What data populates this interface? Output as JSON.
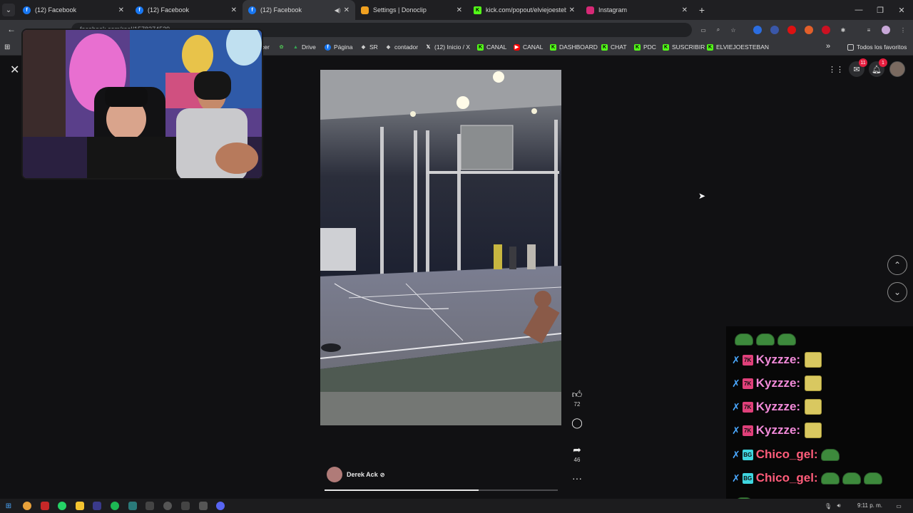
{
  "tabs": [
    {
      "title": "(12) Facebook",
      "favicon": "facebook-icon",
      "active": false
    },
    {
      "title": "(12) Facebook",
      "favicon": "facebook-icon",
      "active": false
    },
    {
      "title": "(12) Facebook",
      "favicon": "facebook-icon",
      "active": true,
      "audio": true
    },
    {
      "title": "Settings | Donoclip",
      "favicon": "donoclip-icon",
      "active": false
    },
    {
      "title": "kick.com/popout/elviejoesteban",
      "favicon": "kick-icon",
      "active": false
    },
    {
      "title": "Instagram",
      "favicon": "instagram-icon",
      "active": false
    }
  ],
  "address_bar": {
    "url": "facebook.com/reel/1578274529"
  },
  "bookmarks": {
    "items": [
      {
        "label": "cer",
        "icon": "bookmark-icon",
        "color": "#9aa0a6"
      },
      {
        "label": "",
        "icon": "leaf-icon",
        "color": "#4caf50"
      },
      {
        "label": "Drive",
        "icon": "drive-icon",
        "color": "#34a853"
      },
      {
        "label": "Página",
        "icon": "facebook-icon",
        "color": "#1877f2"
      },
      {
        "label": "SR",
        "icon": "diamond-icon",
        "color": "#cccccc"
      },
      {
        "label": "contador",
        "icon": "diamond-icon",
        "color": "#cccccc"
      },
      {
        "label": "(12) Inicio / X",
        "icon": "x-icon",
        "color": "#ffffff"
      },
      {
        "label": "CANAL",
        "icon": "kick-icon",
        "color": "#53fc18"
      },
      {
        "label": "CANAL",
        "icon": "youtube-icon",
        "color": "#ff0000"
      },
      {
        "label": "DASHBOARD",
        "icon": "kick-icon",
        "color": "#53fc18"
      },
      {
        "label": "CHAT",
        "icon": "kick-icon",
        "color": "#53fc18"
      },
      {
        "label": "PDC",
        "icon": "kick-icon",
        "color": "#53fc18"
      },
      {
        "label": "SUSCRIBIR",
        "icon": "kick-icon",
        "color": "#53fc18"
      },
      {
        "label": "ELVIEJOESTEBAN",
        "icon": "kick-square-icon",
        "color": "#53fc18"
      }
    ],
    "overflow": "»",
    "all_favorites": "Todos los favoritos"
  },
  "facebook": {
    "messenger_badge": "11",
    "notifications_badge": "1",
    "like_count": "72",
    "share_count": "46",
    "author_name": "Derek Ack",
    "progress": 0.66
  },
  "chat": {
    "messages": [
      {
        "user": "",
        "emotes": 3,
        "type": "frog"
      },
      {
        "user": "Kyzzze:",
        "color": "#f28ad9",
        "badge": "7K",
        "emotes": 1,
        "type": "sponge"
      },
      {
        "user": "Kyzzze:",
        "color": "#f28ad9",
        "badge": "7K",
        "emotes": 1,
        "type": "sponge"
      },
      {
        "user": "Kyzzze:",
        "color": "#f28ad9",
        "badge": "7K",
        "emotes": 1,
        "type": "sponge"
      },
      {
        "user": "Kyzzze:",
        "color": "#f28ad9",
        "badge": "7K",
        "emotes": 1,
        "type": "sponge"
      },
      {
        "user": "Chico_gel:",
        "color": "#ff5c7a",
        "badge": "BG",
        "emotes": 1,
        "type": "frog"
      },
      {
        "user": "Chico_gel:",
        "color": "#ff5c7a",
        "badge": "BG",
        "emotes": 3,
        "type": "frog"
      },
      {
        "user": "",
        "emotes": 1,
        "type": "frog"
      }
    ]
  },
  "taskbar": {
    "clock": "9:11 p. m."
  }
}
